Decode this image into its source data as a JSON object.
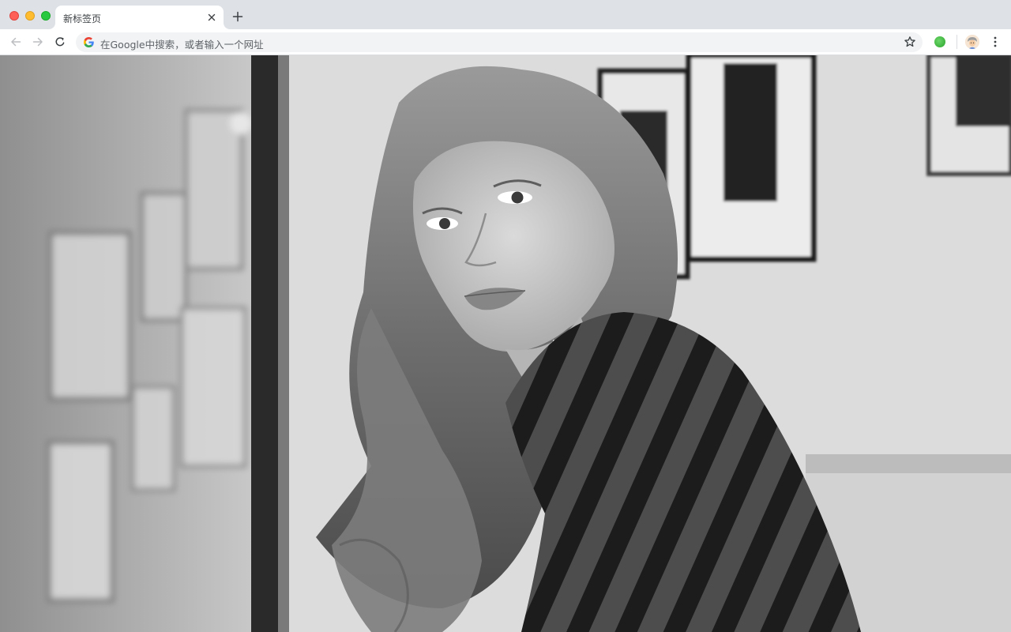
{
  "window": {
    "controls": [
      "close",
      "minimize",
      "maximize"
    ]
  },
  "tabs": [
    {
      "title": "新标签页",
      "active": true,
      "close_icon": "close-icon"
    }
  ],
  "new_tab_icon": "plus-icon",
  "toolbar": {
    "back_icon": "arrow-left-icon",
    "forward_icon": "arrow-right-icon",
    "reload_icon": "reload-icon",
    "omnibox": {
      "placeholder": "在Google中搜索，或者输入一个网址",
      "search_engine_icon": "google-g-icon",
      "bookmark_icon": "star-icon"
    },
    "extension_icon": "green-extension-icon",
    "profile_icon": "avatar-icon",
    "menu_icon": "more-vert-icon"
  },
  "background": {
    "type": "photo",
    "subject": "black-and-white portrait"
  },
  "colors": {
    "tabstrip_bg": "#dee1e6",
    "toolbar_bg": "#ffffff",
    "omnibox_bg": "#f1f3f4",
    "close_red": "#fe5f57",
    "min_yellow": "#febc2e",
    "max_green": "#28c840"
  }
}
